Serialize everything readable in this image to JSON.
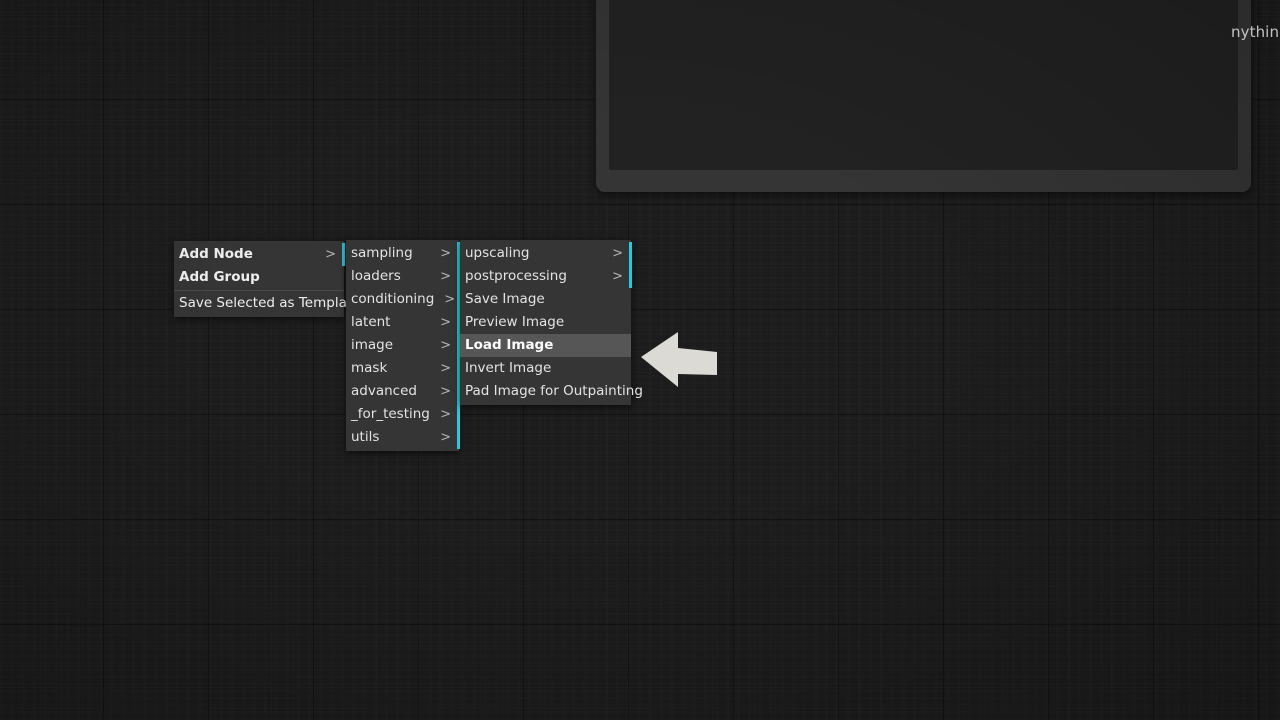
{
  "app": {
    "canvas_bg": "#1c1c1c",
    "accent_cyan": "#26cbdd",
    "menu_bg": "#353535",
    "highlight_bg": "#565656"
  },
  "node_panel": {
    "overflow_text": "nythin"
  },
  "menus": {
    "root": {
      "name": "canvas-context-menu",
      "items": [
        {
          "label": "Add Node",
          "submenu": true,
          "arrow": ">",
          "bold": true,
          "disabled": false,
          "highlight": false
        },
        {
          "label": "Add Group",
          "submenu": false,
          "arrow": "",
          "bold": true,
          "disabled": false,
          "highlight": false
        }
      ],
      "separator_after": 2,
      "items_after": [
        {
          "label": "Save Selected as Template",
          "submenu": false,
          "arrow": "",
          "bold": false,
          "disabled": true,
          "highlight": false
        }
      ]
    },
    "categories": {
      "name": "add-node-category-menu",
      "items": [
        {
          "label": "sampling",
          "submenu": true,
          "arrow": ">"
        },
        {
          "label": "loaders",
          "submenu": true,
          "arrow": ">"
        },
        {
          "label": "conditioning",
          "submenu": true,
          "arrow": ">"
        },
        {
          "label": "latent",
          "submenu": true,
          "arrow": ">"
        },
        {
          "label": "image",
          "submenu": true,
          "arrow": ">"
        },
        {
          "label": "mask",
          "submenu": true,
          "arrow": ">"
        },
        {
          "label": "advanced",
          "submenu": true,
          "arrow": ">"
        },
        {
          "label": "_for_testing",
          "submenu": true,
          "arrow": ">"
        },
        {
          "label": "utils",
          "submenu": true,
          "arrow": ">"
        }
      ]
    },
    "nodes": {
      "name": "image-nodes-menu",
      "items": [
        {
          "label": "upscaling",
          "submenu": true,
          "arrow": ">",
          "highlight": false,
          "bold": false
        },
        {
          "label": "postprocessing",
          "submenu": true,
          "arrow": ">",
          "highlight": false,
          "bold": false
        },
        {
          "label": "Save Image",
          "submenu": false,
          "arrow": "",
          "highlight": false,
          "bold": false
        },
        {
          "label": "Preview Image",
          "submenu": false,
          "arrow": "",
          "highlight": false,
          "bold": false
        },
        {
          "label": "Load Image",
          "submenu": false,
          "arrow": "",
          "highlight": true,
          "bold": true
        },
        {
          "label": "Invert Image",
          "submenu": false,
          "arrow": "",
          "highlight": false,
          "bold": false
        },
        {
          "label": "Pad Image for Outpainting",
          "submenu": false,
          "arrow": "",
          "highlight": false,
          "bold": false
        }
      ]
    }
  },
  "annotation": {
    "arrow_color": "#dcdad5",
    "points_at": "Load Image"
  }
}
